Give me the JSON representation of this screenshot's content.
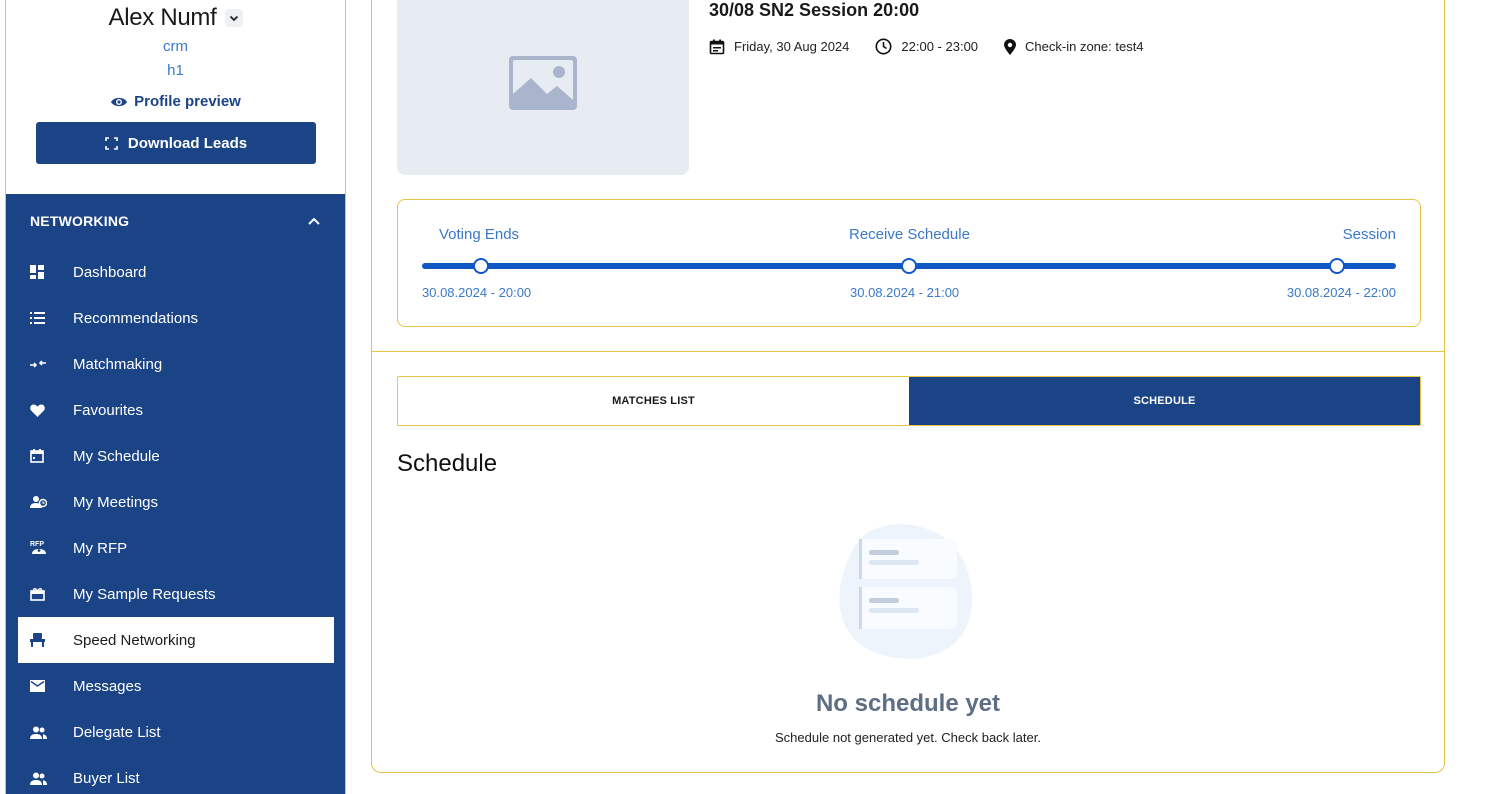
{
  "profile": {
    "name": "Alex Numf",
    "line1": "crm",
    "line2": "h1",
    "preview_label": "Profile preview",
    "download_label": "Download Leads"
  },
  "nav": {
    "section_label": "NETWORKING",
    "items": [
      {
        "label": "Dashboard",
        "icon": "dashboard-icon"
      },
      {
        "label": "Recommendations",
        "icon": "list-icon"
      },
      {
        "label": "Matchmaking",
        "icon": "matchmaking-icon"
      },
      {
        "label": "Favourites",
        "icon": "heart-icon"
      },
      {
        "label": "My Schedule",
        "icon": "calendar-icon"
      },
      {
        "label": "My Meetings",
        "icon": "meetings-icon"
      },
      {
        "label": "My RFP",
        "icon": "rfp-icon"
      },
      {
        "label": "My Sample Requests",
        "icon": "gift-icon"
      },
      {
        "label": "Speed Networking",
        "icon": "chair-icon",
        "active": true
      },
      {
        "label": "Messages",
        "icon": "mail-icon"
      },
      {
        "label": "Delegate List",
        "icon": "people-icon"
      },
      {
        "label": "Buyer List",
        "icon": "person-icon"
      }
    ]
  },
  "session": {
    "title": "30/08 SN2 Session 20:00",
    "date": "Friday, 30 Aug 2024",
    "time": "22:00 - 23:00",
    "location": "Check-in zone: test4"
  },
  "timeline": {
    "steps": [
      {
        "label": "Voting Ends",
        "date": "30.08.2024 - 20:00"
      },
      {
        "label": "Receive Schedule",
        "date": "30.08.2024 - 21:00"
      },
      {
        "label": "Session",
        "date": "30.08.2024 - 22:00"
      }
    ]
  },
  "tabs": {
    "matches": "MATCHES LIST",
    "schedule": "SCHEDULE",
    "active": "schedule"
  },
  "schedule": {
    "heading": "Schedule",
    "empty_title": "No schedule yet",
    "empty_subtitle": "Schedule not generated yet. Check back later."
  },
  "colors": {
    "primary": "#1b4487",
    "accent_border": "#e9c545",
    "link": "#3a78c9",
    "timeline": "#1158c7"
  }
}
